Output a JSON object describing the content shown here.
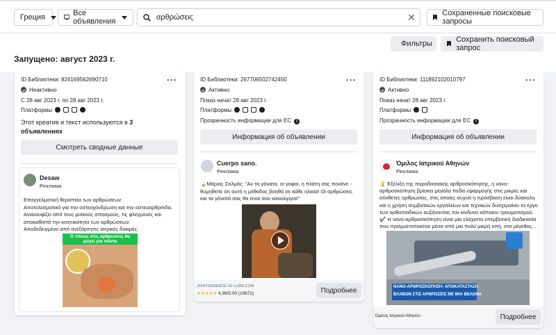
{
  "topbar": {
    "country": "Греция",
    "ad_category": "Все объявления",
    "search_value": "αρθρώσεις",
    "saved_searches": "Сохраненные поисковые запросы"
  },
  "subbar": {
    "filters": "Фильтры",
    "save_search": "Сохранить поисковый запрос",
    "launched": "Запущено: август 2023 г."
  },
  "cards": [
    {
      "library_id": "ID Библиотеки: 824169562690710",
      "status": "Неактивно",
      "dates": "С 28 авг 2023 г. по 28 авг 2023 г.",
      "platforms_label": "Платформы",
      "creative_text_a": "Этот креатив и текст используются в",
      "creative_text_b": "3",
      "creative_text_c": "объявлениях",
      "button": "Смотреть сводные данные",
      "advertiser": "Desaw",
      "sponsored": "Реклама",
      "ad_text": "Επαγγελματική θεραπεία των αρθρώσεων.\nΑποτελεσματικό για την οστεοχόνδρωση και την οστεοαρθρίτιδα.\nΑνακουφίζει από τους μυϊκούς σπασμούς, τις φλεγμονές και αποκαθιστά την κινητικότητα των αρθρώσεων.\nΑποδεδειγμένο από ανεξάρτητες ιατρικές δοκιμές.",
      "image_caption": "Ο πόνος στις αρθρώσεις θα φύγει για πάντα"
    },
    {
      "library_id": "ID Библиотеки: 267706502742450",
      "status": "Активно",
      "dates": "Показ начат 28 авг 2023 г.",
      "platforms_label": "Платформы",
      "transparency": "Прозрачность информации для ЕС",
      "button": "Информация об объявлении",
      "advertiser": "Cuerpo sano.",
      "sponsored": "Реклама",
      "ad_text": "🍃Μάριος Σαλμάς: \"Αν τα γόνατα, οι γοφοί, η πλάτη σας πονάνε - θυμηθείτε ότι αυτή η μέθοδος βοηθά σε κάθε ηλικία! Οι αρθρώσεις και τα γόνατά σας θα είναι σαν καινούργια!\"",
      "link_domain": "JOINTSGREECE.VE-LURE.COM",
      "rating": "★★★★★ 4,99/5.00 (19672)",
      "more": "Подробнее"
    },
    {
      "library_id": "ID Библиотеки: 1118921020107​97",
      "status": "Активно",
      "dates": "Показ начат 28 авг 2023 г.",
      "platforms_label": "Платформы",
      "transparency": "Прозрачность информации для ЕС",
      "button": "Информация об объявлении",
      "advertiser": "Όμιλος Ιατρικού Αθηνών",
      "sponsored": "Реклама",
      "ad_text": "💡 Εξέλιξη της παραδοσιακής αρθροσκόπησης, η νανο-αρθροσκόπηση βρίσκει μεγάλο πεδίο εφαρμογής στις μικρές και σύνθετες αρθρώσεις, στις οποίες συχνά η πρόσβαση είναι δύσκολη και η χρήση συμβατικών εργαλείων και τεχνικών δυσχεραίνει το έργο των ορθοπαιδικών αυξάνοντας τον κίνδυνο κάποιου τραυματισμού.\n✔️ Η νανο-αρθροσκόπηση είναι μία ελάχιστα επεμβατική διαδικασία που πραγματοποιείται μέσα από μια πολύ μικρή οπή, στο μέγεθος...",
      "image_caption_a": "ΝΑΝΟ-ΑΡΘΡΟΣΚΟΠΗΣΗ: ΑΠΟΚΑΤΑΣΤΑΣΗ",
      "image_caption_b": "ΒΛΑΒΩΝ ΣΤΙΣ ΑΡΘΡΩΣΕΙΣ ΜΕ ΜΙΑ ΒΕΛΟΝΑ",
      "footer_name": "Όμιλος Ιατρικού Αθηνών",
      "more": "Подробнее"
    }
  ]
}
